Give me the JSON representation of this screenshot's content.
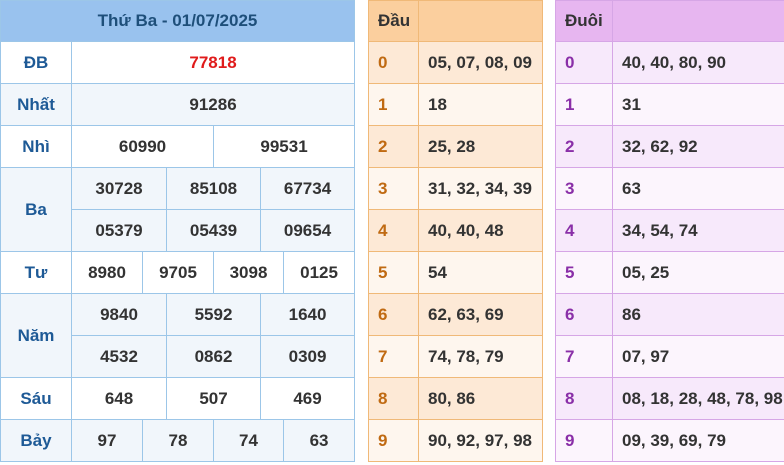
{
  "header": {
    "title": "Thứ Ba - 01/07/2025"
  },
  "prizes": {
    "db": {
      "label": "ĐB",
      "values": [
        "77818"
      ]
    },
    "nhat": {
      "label": "Nhất",
      "values": [
        "91286"
      ]
    },
    "nhi": {
      "label": "Nhì",
      "values": [
        "60990",
        "99531"
      ]
    },
    "ba": {
      "label": "Ba",
      "values": [
        "30728",
        "85108",
        "67734",
        "05379",
        "05439",
        "09654"
      ]
    },
    "tu": {
      "label": "Tư",
      "values": [
        "8980",
        "9705",
        "3098",
        "0125"
      ]
    },
    "nam": {
      "label": "Năm",
      "values": [
        "9840",
        "5592",
        "1640",
        "4532",
        "0862",
        "0309"
      ]
    },
    "sau": {
      "label": "Sáu",
      "values": [
        "648",
        "507",
        "469"
      ]
    },
    "bay": {
      "label": "Bảy",
      "values": [
        "97",
        "78",
        "74",
        "63"
      ]
    }
  },
  "dau": {
    "header": "Đầu",
    "rows": [
      {
        "key": "0",
        "values": "05, 07, 08, 09"
      },
      {
        "key": "1",
        "values": "18"
      },
      {
        "key": "2",
        "values": "25, 28"
      },
      {
        "key": "3",
        "values": "31, 32, 34, 39"
      },
      {
        "key": "4",
        "values": "40, 40, 48"
      },
      {
        "key": "5",
        "values": "54"
      },
      {
        "key": "6",
        "values": "62, 63, 69"
      },
      {
        "key": "7",
        "values": "74, 78, 79"
      },
      {
        "key": "8",
        "values": "80, 86"
      },
      {
        "key": "9",
        "values": "90, 92, 97, 98"
      }
    ]
  },
  "duoi": {
    "header": "Đuôi",
    "rows": [
      {
        "key": "0",
        "values": "40, 40, 80, 90"
      },
      {
        "key": "1",
        "values": "31"
      },
      {
        "key": "2",
        "values": "32, 62, 92"
      },
      {
        "key": "3",
        "values": "63"
      },
      {
        "key": "4",
        "values": "34, 54, 74"
      },
      {
        "key": "5",
        "values": "05, 25"
      },
      {
        "key": "6",
        "values": "86"
      },
      {
        "key": "7",
        "values": "07, 97"
      },
      {
        "key": "8",
        "values": "08, 18, 28, 48, 78, 98"
      },
      {
        "key": "9",
        "values": "09, 39, 69, 79"
      }
    ]
  }
}
